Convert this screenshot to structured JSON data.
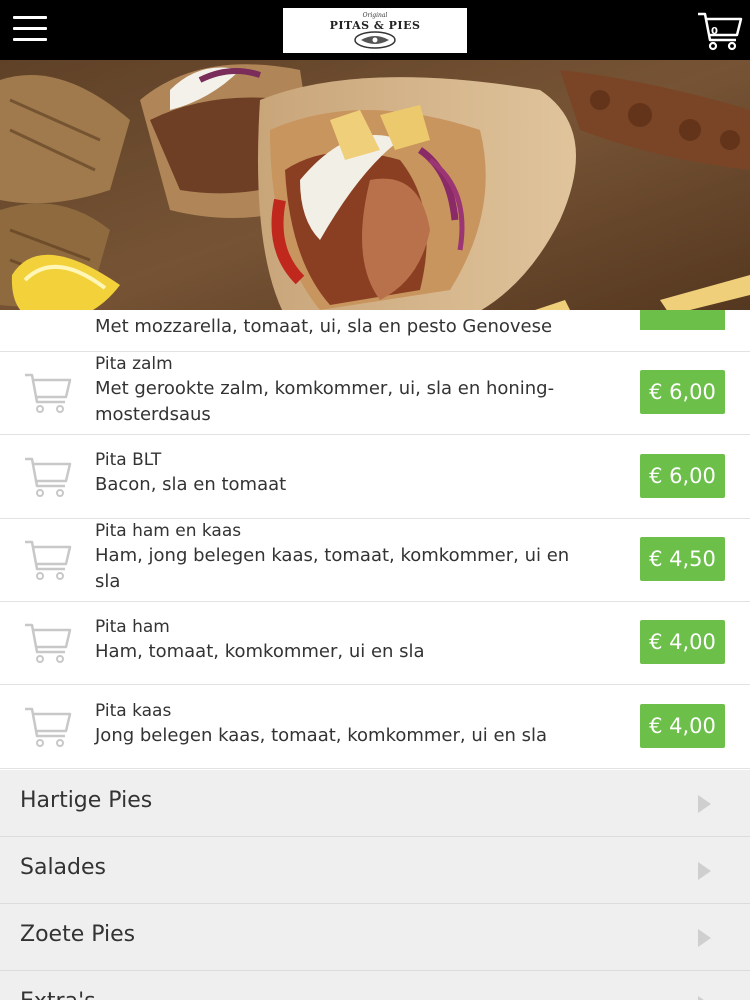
{
  "header": {
    "logo_script": "Original",
    "logo_text": "PITAS & PIES",
    "cart_count": "0"
  },
  "partial_item": {
    "description": "Met mozzarella, tomaat, ui, sla en pesto Genovese"
  },
  "items": [
    {
      "name": "Pita zalm",
      "description": "Met gerookte zalm, komkommer, ui, sla en honing-mosterdsaus",
      "price": "€ 6,00"
    },
    {
      "name": "Pita BLT",
      "description": "Bacon, sla en tomaat",
      "price": "€ 6,00"
    },
    {
      "name": "Pita ham en kaas",
      "description": "Ham, jong belegen kaas, tomaat, komkommer, ui en sla",
      "price": "€ 4,50"
    },
    {
      "name": "Pita ham",
      "description": "Ham, tomaat, komkommer, ui en sla",
      "price": "€ 4,00"
    },
    {
      "name": "Pita kaas",
      "description": "Jong belegen kaas, tomaat, komkommer, ui en sla",
      "price": "€ 4,00"
    }
  ],
  "categories": [
    {
      "label": "Hartige Pies"
    },
    {
      "label": "Salades"
    },
    {
      "label": "Zoete Pies"
    },
    {
      "label": "Extra's"
    }
  ],
  "colors": {
    "header_bg": "#000000",
    "price_green": "#6cc04a",
    "category_bg": "#efefef"
  }
}
